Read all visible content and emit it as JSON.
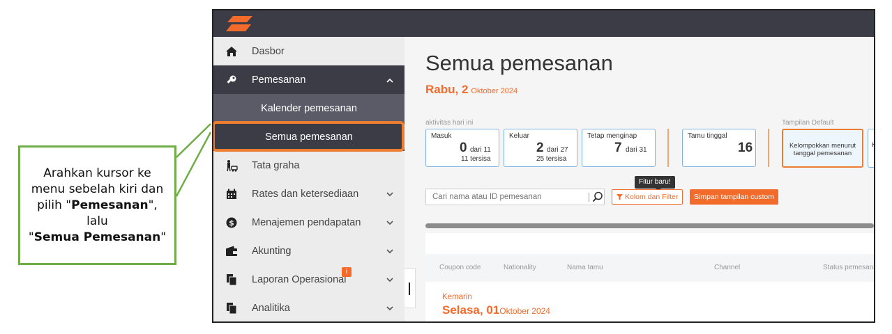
{
  "callout": {
    "line1": "Arahkan kursor ke",
    "line2": "menu sebelah kiri dan",
    "line3_pre": "pilih \"",
    "line3_bold": "Pemesanan",
    "line3_post": "\",",
    "line4": "lalu",
    "line5_pre": "\"",
    "line5_bold": "Semua Pemesanan",
    "line5_post": "\""
  },
  "colors": {
    "accent": "#f26b2a",
    "highlight": "#ed7d31",
    "callout_border": "#70ad47",
    "nav_dark": "#3b3c46"
  },
  "sidebar": {
    "items": [
      {
        "label": "Dasbor",
        "icon": "home-icon"
      },
      {
        "label": "Pemesanan",
        "icon": "key-icon",
        "chevron": "^"
      },
      {
        "label": "Tata graha",
        "icon": "housekeeping-icon"
      },
      {
        "label": "Rates dan ketersediaan",
        "icon": "calendar-icon",
        "chevron": "⌄"
      },
      {
        "label": "Menajemen pendapatan",
        "icon": "dollar-icon",
        "chevron": "⌄"
      },
      {
        "label": "Akunting",
        "icon": "wallet-icon",
        "chevron": "⌄"
      },
      {
        "label": "Laporan Operasional",
        "icon": "report-icon",
        "chevron": "⌄"
      },
      {
        "label": "Analitika",
        "icon": "analytics-icon",
        "chevron": "⌄",
        "badge": "i"
      }
    ],
    "subitems": [
      {
        "label": "Kalender pemesanan"
      },
      {
        "label": "Semua pemesanan"
      }
    ]
  },
  "main": {
    "title": "Semua pemesanan",
    "date_day": "Rabu, 2",
    "date_month": "Oktober 2024",
    "today_label": "aktivitas hari ini",
    "default_view_label": "Tampilan Default",
    "stats": [
      {
        "title": "Masuk",
        "value": "0",
        "of": "dari 11",
        "remaining": "11 tersisa"
      },
      {
        "title": "Keluar",
        "value": "2",
        "of": "dari 27",
        "remaining": "25 tersisa"
      },
      {
        "title": "Tetap menginap",
        "value": "7",
        "of": "dari 31"
      },
      {
        "title": "Tamu tinggal",
        "value": "16"
      }
    ],
    "group_view": {
      "line1": "Kelompokkan menurut",
      "line2": "tanggal pemesanan"
    },
    "group_view2": "K",
    "tooltip": "Fitur baru!",
    "search_placeholder": "Cari nama atau ID pemesanan",
    "filter_button": "Kolom dan Filter",
    "save_button": "Simpan tampilan custom",
    "columns": [
      "Coupon code",
      "Nationality",
      "Nama tamu",
      "Channel",
      "Status pemesanan"
    ],
    "group": {
      "label": "Kemarin",
      "day": "Selasa, 01",
      "month": "Oktober 2024"
    }
  }
}
